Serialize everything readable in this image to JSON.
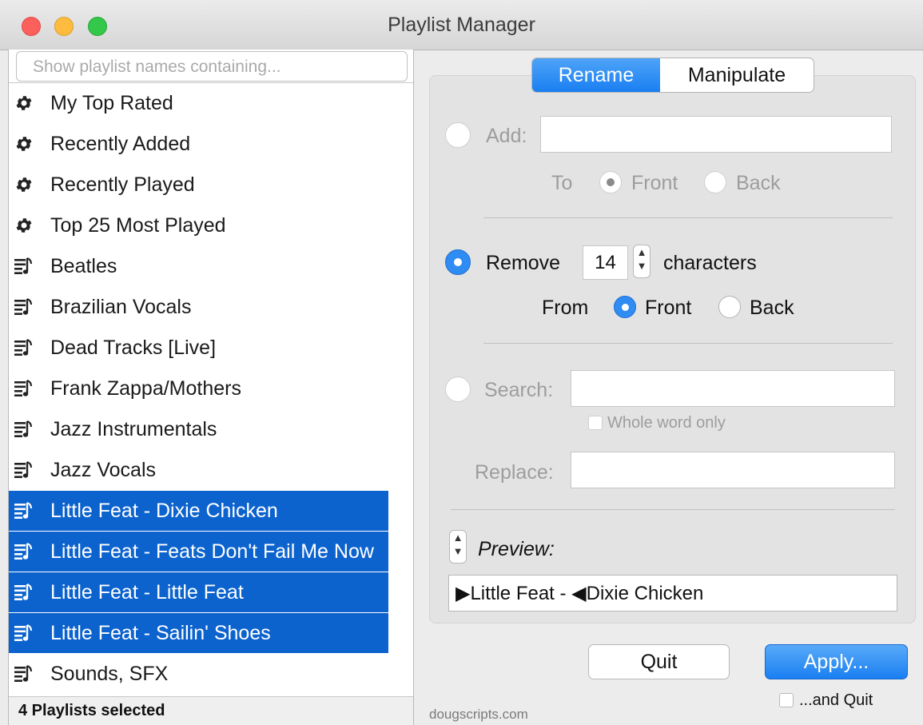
{
  "window": {
    "title": "Playlist Manager"
  },
  "sidebar": {
    "filter_placeholder": "Show playlist names containing...",
    "items": [
      {
        "label": "My Top Rated",
        "icon": "gear-icon",
        "selected": false
      },
      {
        "label": "Recently Added",
        "icon": "gear-icon",
        "selected": false
      },
      {
        "label": "Recently Played",
        "icon": "gear-icon",
        "selected": false
      },
      {
        "label": "Top 25 Most Played",
        "icon": "gear-icon",
        "selected": false
      },
      {
        "label": "Beatles",
        "icon": "playlist-icon",
        "selected": false
      },
      {
        "label": "Brazilian Vocals",
        "icon": "playlist-icon",
        "selected": false
      },
      {
        "label": "Dead Tracks [Live]",
        "icon": "playlist-icon",
        "selected": false
      },
      {
        "label": "Frank Zappa/Mothers",
        "icon": "playlist-icon",
        "selected": false
      },
      {
        "label": "Jazz Instrumentals",
        "icon": "playlist-icon",
        "selected": false
      },
      {
        "label": "Jazz Vocals",
        "icon": "playlist-icon",
        "selected": false
      },
      {
        "label": "Little Feat - Dixie Chicken",
        "icon": "playlist-icon",
        "selected": true
      },
      {
        "label": "Little Feat - Feats Don't Fail Me Now",
        "icon": "playlist-icon",
        "selected": true
      },
      {
        "label": "Little Feat - Little Feat",
        "icon": "playlist-icon",
        "selected": true
      },
      {
        "label": "Little Feat - Sailin' Shoes",
        "icon": "playlist-icon",
        "selected": true
      },
      {
        "label": "Sounds, SFX",
        "icon": "playlist-icon",
        "selected": false
      }
    ],
    "status": "4 Playlists selected"
  },
  "tabs": [
    {
      "label": "Rename",
      "active": true
    },
    {
      "label": "Manipulate",
      "active": false
    }
  ],
  "add": {
    "label": "Add:",
    "value": "",
    "to_label": "To",
    "front_label": "Front",
    "back_label": "Back",
    "selected_position": "Front"
  },
  "remove": {
    "label": "Remove",
    "count": "14",
    "unit": "characters",
    "from_label": "From",
    "front_label": "Front",
    "back_label": "Back",
    "selected_position": "Front"
  },
  "search": {
    "label": "Search:",
    "value": "",
    "whole_word_label": "Whole word only",
    "replace_label": "Replace:",
    "replace_value": ""
  },
  "selected_option": "Remove",
  "preview": {
    "label": "Preview:",
    "value": "▶Little Feat - ◀Dixie Chicken"
  },
  "buttons": {
    "quit": "Quit",
    "apply": "Apply...",
    "and_quit": "...and Quit"
  },
  "footer": "dougscripts.com",
  "colors": {
    "accent": "#2f8cf3",
    "selection": "#0c63ce"
  }
}
